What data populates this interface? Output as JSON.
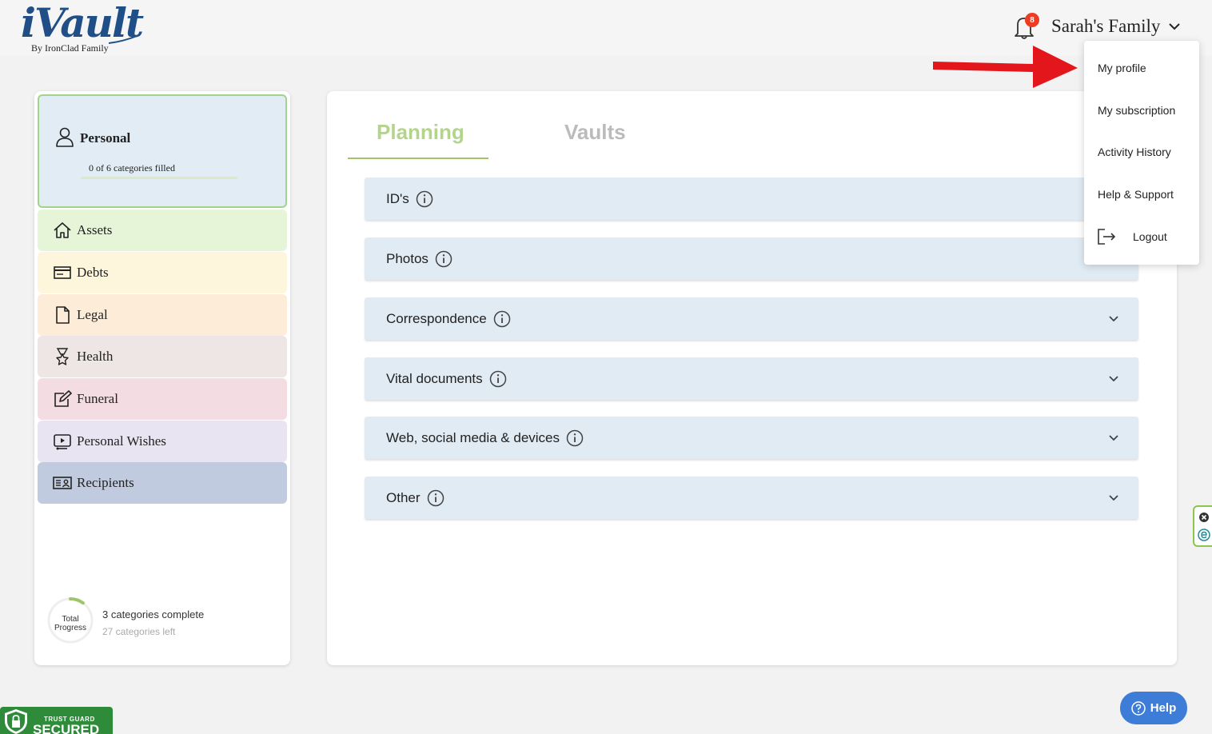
{
  "header": {
    "logo_text": "iVault",
    "logo_subtitle": "By IronClad Family",
    "notification_count": "8",
    "family_name": "Sarah's Family"
  },
  "sidebar": {
    "personal": {
      "title": "Personal",
      "subtitle": "0 of 6 categories filled"
    },
    "categories": [
      {
        "label": "Assets",
        "icon": "home-icon",
        "color": "#e6f5d8"
      },
      {
        "label": "Debts",
        "icon": "credit-card-icon",
        "color": "#fdf6dc"
      },
      {
        "label": "Legal",
        "icon": "document-icon",
        "color": "#fdecd8"
      },
      {
        "label": "Health",
        "icon": "medal-icon",
        "color": "#ede6e4"
      },
      {
        "label": "Funeral",
        "icon": "edit-icon",
        "color": "#f3dde2"
      },
      {
        "label": "Personal Wishes",
        "icon": "video-icon",
        "color": "#e9e4f2"
      },
      {
        "label": "Recipients",
        "icon": "contact-card-icon",
        "color": "#c1cbdf"
      }
    ],
    "progress": {
      "label": "Total Progress",
      "complete_text": "3 categories complete",
      "left_text": "27 categories left",
      "fraction": 0.1
    }
  },
  "main": {
    "tabs": [
      {
        "label": "Planning",
        "active": true
      },
      {
        "label": "Vaults",
        "active": false
      }
    ],
    "sections": [
      {
        "label": "ID's"
      },
      {
        "label": "Photos"
      },
      {
        "label": "Correspondence"
      },
      {
        "label": "Vital documents"
      },
      {
        "label": "Web, social media & devices"
      },
      {
        "label": "Other"
      }
    ]
  },
  "dropdown": {
    "items": [
      "My profile",
      "My subscription",
      "Activity History",
      "Help & Support"
    ],
    "logout": "Logout"
  },
  "help_button": "Help",
  "trust_badge": {
    "top": "TRUST GUARD",
    "main": "SECURED"
  },
  "colors": {
    "accent_green": "#9fc46a",
    "brand_blue": "#1f4f86",
    "help_blue": "#3d7dd8",
    "arrow_red": "#e3171b"
  }
}
